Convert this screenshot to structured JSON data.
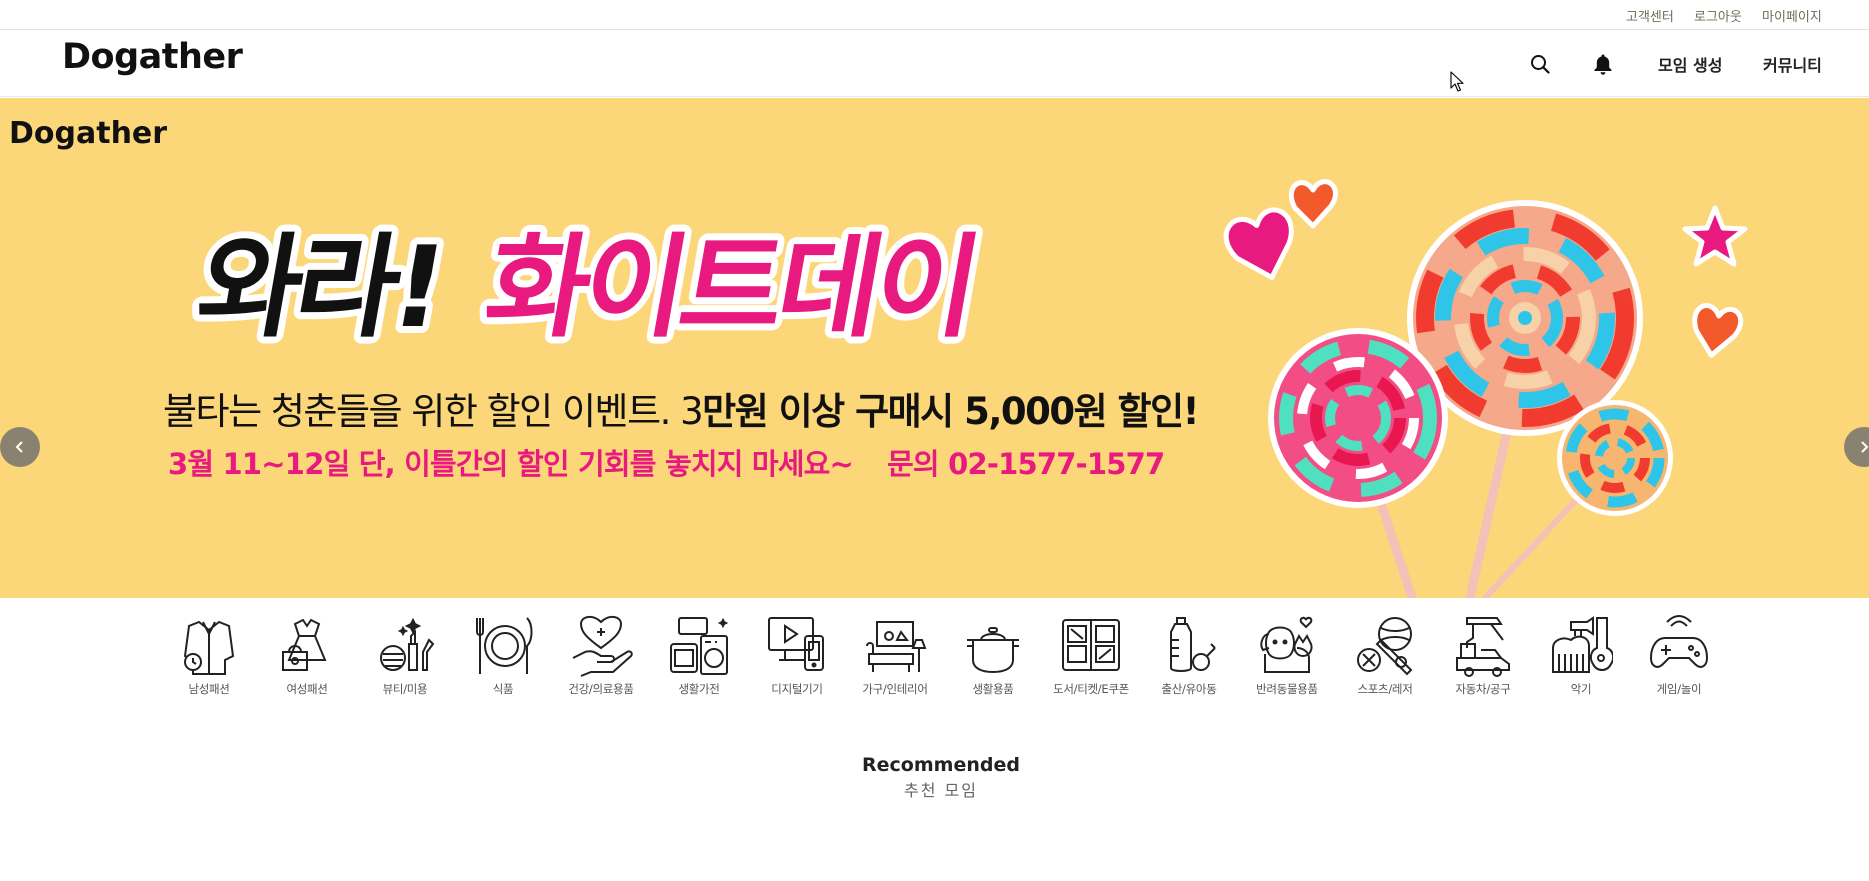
{
  "utility_bar": {
    "customer_center": "고객센터",
    "logout": "로그아웃",
    "mypage": "마이페이지"
  },
  "header": {
    "logo": "Dogather",
    "icons": [
      "search-icon",
      "bell-icon"
    ],
    "create_group": "모임 생성",
    "community": "커뮤니티"
  },
  "banner": {
    "brand": "Dogather",
    "headline_black": "와라!",
    "headline_pink": "화이트데이",
    "subline_normal": "불타는 청춘들을 위한 할인 이벤트. 3",
    "subline_bold": "만원 이상 구매시 5,000원 할인!",
    "notice": "3월 11~12일 단, 이틀간의 할인 기회를 놓치지 마세요~",
    "contact": "문의 02-1577-1577",
    "colors": {
      "background": "#fcd779",
      "accent": "#e8197f",
      "arrow": "#8a8270"
    },
    "icons": [
      "chevron-left-icon",
      "chevron-right-icon"
    ]
  },
  "categories": [
    {
      "label": "남성패션",
      "icon": "mens-fashion-icon"
    },
    {
      "label": "여성패션",
      "icon": "womens-fashion-icon"
    },
    {
      "label": "뷰티/미용",
      "icon": "beauty-icon"
    },
    {
      "label": "식품",
      "icon": "food-icon"
    },
    {
      "label": "건강/의료용품",
      "icon": "health-icon"
    },
    {
      "label": "생활가전",
      "icon": "appliance-icon"
    },
    {
      "label": "디지털기기",
      "icon": "digital-device-icon"
    },
    {
      "label": "가구/인테리어",
      "icon": "furniture-icon"
    },
    {
      "label": "생활용품",
      "icon": "household-icon"
    },
    {
      "label": "도서/티켓/E쿠폰",
      "icon": "book-ticket-icon"
    },
    {
      "label": "출산/유아동",
      "icon": "baby-icon"
    },
    {
      "label": "반려동물용품",
      "icon": "pet-icon"
    },
    {
      "label": "스포츠/레저",
      "icon": "sports-icon"
    },
    {
      "label": "자동차/공구",
      "icon": "car-tools-icon"
    },
    {
      "label": "악기",
      "icon": "instrument-icon"
    },
    {
      "label": "게임/놀이",
      "icon": "game-icon"
    }
  ],
  "recommended": {
    "title": "Recommended",
    "subtitle": "추천 모임"
  }
}
